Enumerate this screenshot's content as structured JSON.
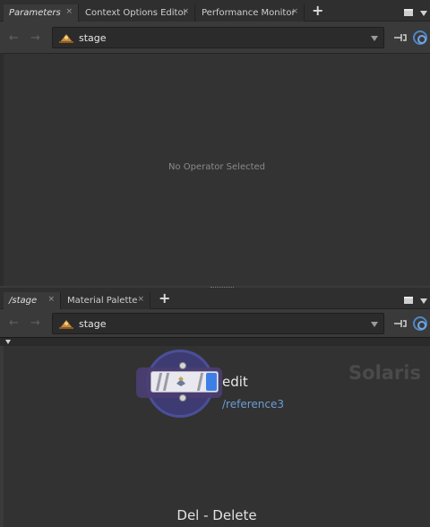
{
  "top_pane": {
    "tabs": [
      {
        "label": "Parameters",
        "close": "×"
      },
      {
        "label": "Context Options Editor",
        "close": "×"
      },
      {
        "label": "Performance Monitor",
        "close": "×"
      }
    ],
    "add_tab": "+",
    "path": "stage",
    "placeholder": "No Operator Selected"
  },
  "bottom_pane": {
    "tabs": [
      {
        "label": "/stage",
        "close": "×"
      },
      {
        "label": "Material Palette",
        "close": "×"
      }
    ],
    "add_tab": "+",
    "path": "stage",
    "context_watermark": "Solaris",
    "node": {
      "name": "edit",
      "path": "/reference3"
    },
    "hint": "Del - Delete"
  },
  "icons": {
    "back": "←",
    "forward": "→",
    "pin": "pin-icon",
    "target": "target-icon",
    "stage": "stage-icon"
  },
  "colors": {
    "accent_blue": "#3d7fe6",
    "node_ring": "#4b4f98",
    "path_link": "#6c9dd6"
  }
}
